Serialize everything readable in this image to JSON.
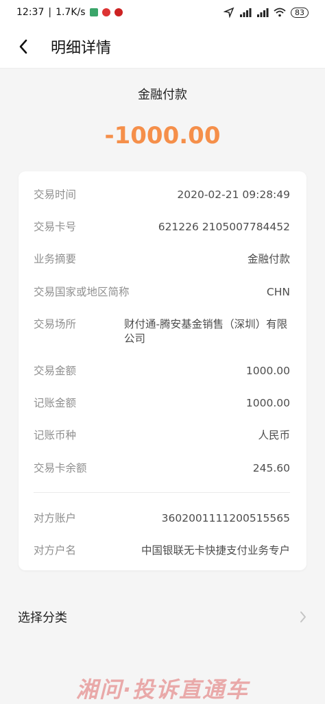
{
  "status_bar": {
    "time": "12:37",
    "speed": "1.7K/s",
    "battery": "83"
  },
  "nav": {
    "title": "明细详情"
  },
  "transaction": {
    "category": "金融付款",
    "amount": "-1000.00"
  },
  "details": [
    {
      "label": "交易时间",
      "value": "2020-02-21 09:28:49"
    },
    {
      "label": "交易卡号",
      "value": "621226 2105007784452"
    },
    {
      "label": "业务摘要",
      "value": "金融付款"
    },
    {
      "label": "交易国家或地区简称",
      "value": "CHN"
    },
    {
      "label": "交易场所",
      "value": "财付通-腾安基金销售（深圳）有限公司"
    },
    {
      "label": "交易金额",
      "value": "1000.00"
    },
    {
      "label": "记账金额",
      "value": "1000.00"
    },
    {
      "label": "记账币种",
      "value": "人民币"
    },
    {
      "label": "交易卡余额",
      "value": "245.60"
    },
    {
      "label": "对方账户",
      "value": "3602001111200515565"
    },
    {
      "label": "对方户名",
      "value": "中国银联无卡快捷支付业务专户"
    }
  ],
  "select_category": {
    "label": "选择分类"
  },
  "watermark": {
    "text": "湘问·投诉直通车"
  },
  "colors": {
    "amount": "#f58f4a",
    "label": "#8f8f8f",
    "value": "#4d4d4d"
  }
}
